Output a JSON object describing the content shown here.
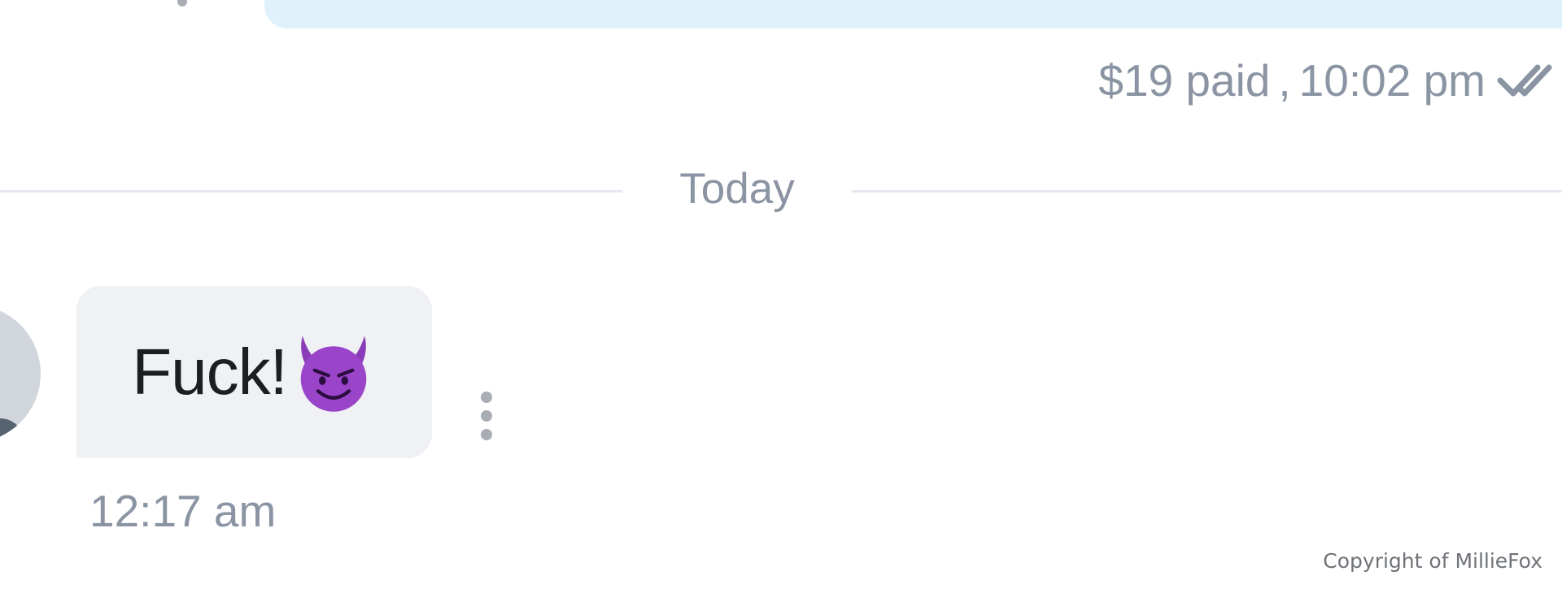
{
  "previous_message": {
    "status": "$19 paid",
    "separator": ",",
    "time": "10:02 pm",
    "read_icon": "double-check-icon"
  },
  "divider": {
    "label": "Today"
  },
  "message": {
    "text": "Fuck!",
    "emoji_icon": "smiling-devil-emoji-icon",
    "time": "12:17 am",
    "menu_icon": "vertical-dots-icon"
  },
  "watermark": {
    "text": "Copyright of MillieFox"
  },
  "colors": {
    "outgoing_bubble": "#dff2fb",
    "incoming_bubble": "#eff1f4",
    "meta_text": "#8a94a3",
    "divider_line": "#e6e8f1",
    "emoji": "#8a3bb8"
  }
}
